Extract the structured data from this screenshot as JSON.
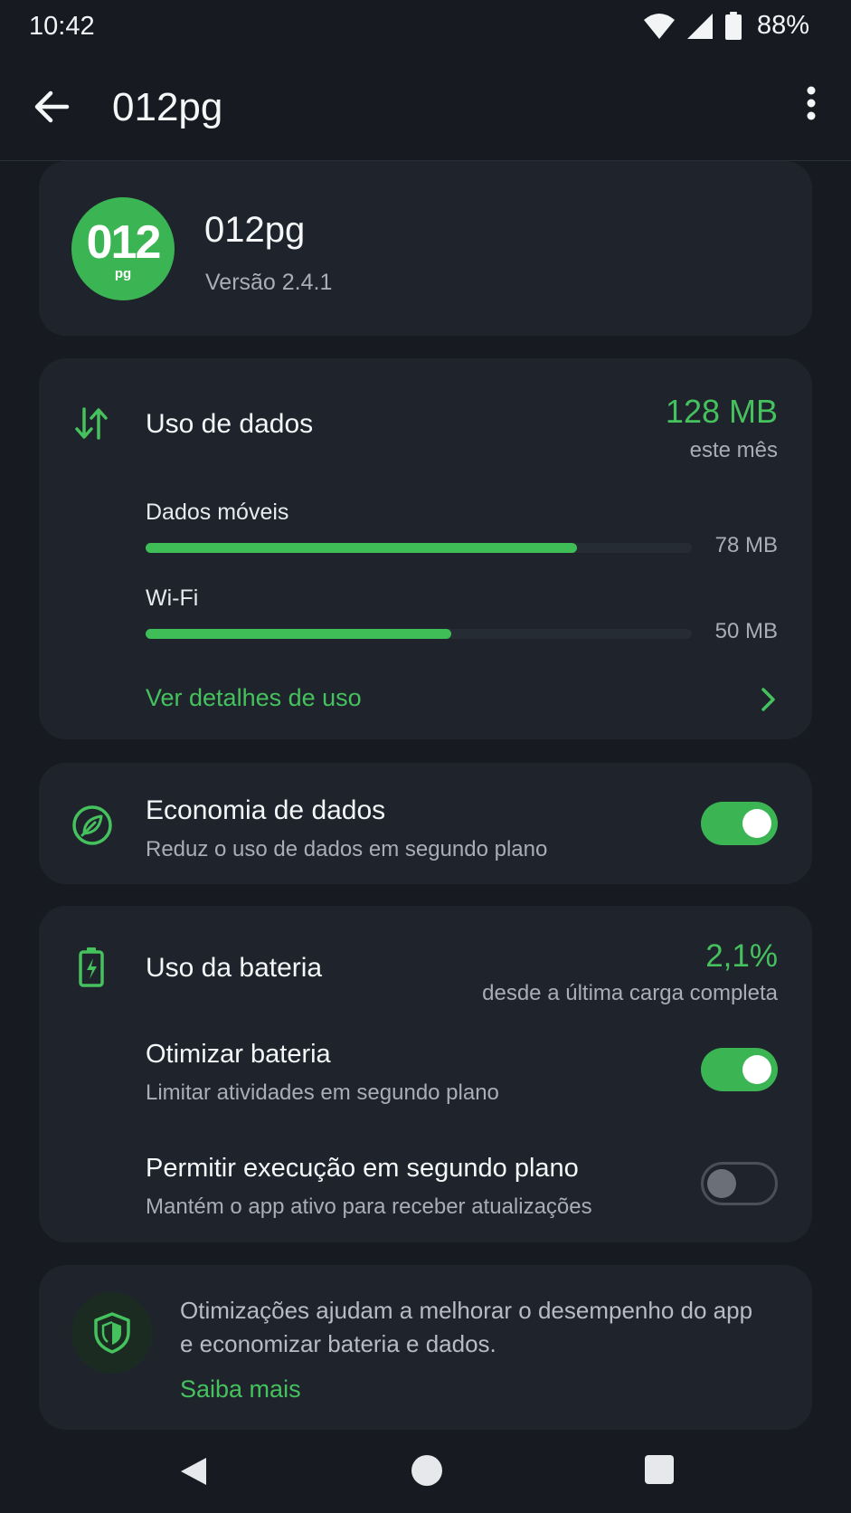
{
  "status_bar": {
    "time": "10:42",
    "battery_text": "88%",
    "icons": [
      "wifi-icon",
      "cell-signal-icon",
      "battery-icon"
    ]
  },
  "app_bar": {
    "title": "012pg",
    "back_icon": "arrow-left-icon",
    "more_icon": "more-vertical-icon"
  },
  "app_info": {
    "logo_main": "012",
    "logo_sub": "pg",
    "name": "012pg",
    "version": "Versão 2.4.1",
    "logo_color": "#3bb553"
  },
  "data_usage": {
    "icon": "data-transfer-icon",
    "title": "Uso de dados",
    "total": "128 MB",
    "period": "este mês",
    "items": [
      {
        "label": "Dados móveis",
        "value": "78 MB",
        "fill_fraction": 0.79
      },
      {
        "label": "Wi-Fi",
        "value": "50 MB",
        "fill_fraction": 0.56
      }
    ],
    "details_link": "Ver detalhes de uso"
  },
  "data_saver": {
    "icon": "data-saver-icon",
    "title": "Economia de dados",
    "subtitle": "Reduz o uso de dados em segundo plano",
    "enabled": true
  },
  "battery": {
    "icon": "battery-charging-icon",
    "title": "Uso da bateria",
    "percent": "2,1%",
    "since": "desde a última carga completa",
    "settings": [
      {
        "title": "Otimizar bateria",
        "subtitle": "Limitar atividades em segundo plano",
        "enabled": true
      },
      {
        "title": "Permitir execução em segundo plano",
        "subtitle": "Mantém o app ativo para receber atualizações",
        "enabled": false
      }
    ]
  },
  "info": {
    "icon": "shield-icon",
    "text": "Otimizações ajudam a melhorar o desempenho do app e economizar bateria e dados.",
    "link": "Saiba mais"
  },
  "colors": {
    "accent": "#45c15d",
    "background": "#171b21",
    "card": "#1f242c"
  }
}
